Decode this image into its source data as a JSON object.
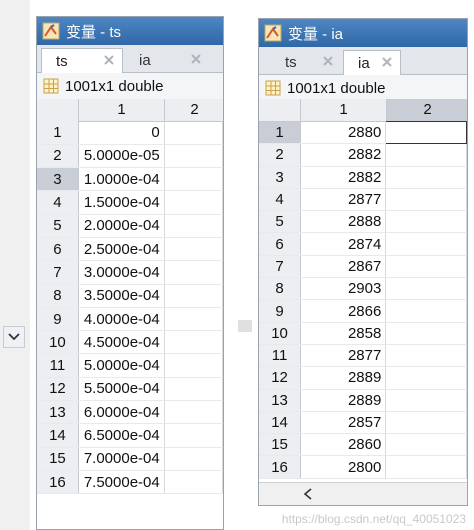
{
  "left_panel": {
    "title": "变量 - ts",
    "tabs": [
      {
        "label": "ts",
        "active": true
      },
      {
        "label": "ia",
        "active": false
      }
    ],
    "info": "1001x1 double",
    "columns": [
      "1",
      "2"
    ],
    "selected_row": "3",
    "rows": [
      {
        "row": "1",
        "value": "0"
      },
      {
        "row": "2",
        "value": "5.0000e-05"
      },
      {
        "row": "3",
        "value": "1.0000e-04"
      },
      {
        "row": "4",
        "value": "1.5000e-04"
      },
      {
        "row": "5",
        "value": "2.0000e-04"
      },
      {
        "row": "6",
        "value": "2.5000e-04"
      },
      {
        "row": "7",
        "value": "3.0000e-04"
      },
      {
        "row": "8",
        "value": "3.5000e-04"
      },
      {
        "row": "9",
        "value": "4.0000e-04"
      },
      {
        "row": "10",
        "value": "4.5000e-04"
      },
      {
        "row": "11",
        "value": "5.0000e-04"
      },
      {
        "row": "12",
        "value": "5.5000e-04"
      },
      {
        "row": "13",
        "value": "6.0000e-04"
      },
      {
        "row": "14",
        "value": "6.5000e-04"
      },
      {
        "row": "15",
        "value": "7.0000e-04"
      },
      {
        "row": "16",
        "value": "7.5000e-04"
      }
    ]
  },
  "right_panel": {
    "title": "变量 - ia",
    "tabs": [
      {
        "label": "ts",
        "active": false
      },
      {
        "label": "ia",
        "active": true
      }
    ],
    "info": "1001x1 double",
    "columns": [
      "1",
      "2"
    ],
    "selected_row": "1",
    "rows": [
      {
        "row": "1",
        "value": "2880"
      },
      {
        "row": "2",
        "value": "2882"
      },
      {
        "row": "3",
        "value": "2882"
      },
      {
        "row": "4",
        "value": "2877"
      },
      {
        "row": "5",
        "value": "2888"
      },
      {
        "row": "6",
        "value": "2874"
      },
      {
        "row": "7",
        "value": "2867"
      },
      {
        "row": "8",
        "value": "2903"
      },
      {
        "row": "9",
        "value": "2866"
      },
      {
        "row": "10",
        "value": "2858"
      },
      {
        "row": "11",
        "value": "2877"
      },
      {
        "row": "12",
        "value": "2889"
      },
      {
        "row": "13",
        "value": "2889"
      },
      {
        "row": "14",
        "value": "2857"
      },
      {
        "row": "15",
        "value": "2860"
      },
      {
        "row": "16",
        "value": "2800"
      }
    ]
  },
  "icons": {
    "app": "matlab-variable-icon",
    "tab_close": "close-icon",
    "info": "grid-icon",
    "collapse": "chevron-down-icon",
    "scroll_left": "chevron-left-icon"
  },
  "watermark": "https://blog.csdn.net/qq_40051023"
}
